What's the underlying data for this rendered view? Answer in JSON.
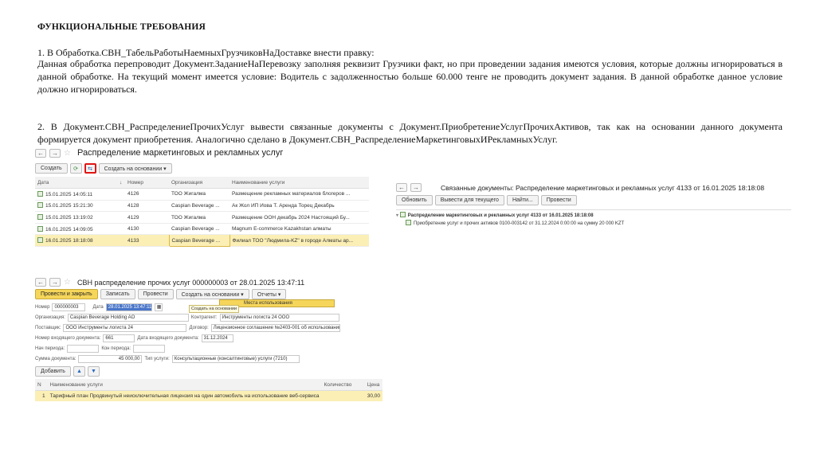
{
  "doc": {
    "heading": "ФУНКЦИОНАЛЬНЫЕ ТРЕБОВАНИЯ",
    "item1_title": "1.   В Обработка.СВН_ТабельРаботыНаемныхГрузчиковНаДоставке внести правку:",
    "item1_body": "Данная обработка перепроводит Документ.ЗаданиеНаПеревозку заполняя реквизит Грузчики факт, но при проведении задания имеются условия, которые должны игнорироваться в данной обработке. На текущий момент имеется условие: Водитель с задолженностью больше 60.000 тенге не проводить документ задания. В данной обработке данное условие должно игнорироваться.",
    "item2_body": "2. В Документ.СВН_РаспределениеПрочихУслуг вывести связанные документы с Документ.ПриобретениеУслугПрочихАктивов, так как на основании данного документа формируется документ приобретения. Аналогично сделано в Документ.СВН_РаспределениеМаркетинговыхИРекламныхУслуг."
  },
  "list_window": {
    "title": "Распределение маркетинговых и рекламных услуг",
    "create_btn": "Создать",
    "create_based_btn": "Создать на основании ▾",
    "columns": [
      "Дата",
      "↓",
      "Номер",
      "Организация",
      "Наименование услуги"
    ],
    "rows": [
      {
        "date": "15.01.2025 14:05:11",
        "num": "4126",
        "org": "ТОО Жигалма",
        "name": "Размещение рекламных материалов  блогеров ..."
      },
      {
        "date": "15.01.2025 15:21:30",
        "num": "4128",
        "org": "Caspian Beverage ...",
        "name": "Ак Жол ИП Иова Т. Аренда Торец Декабрь"
      },
      {
        "date": "15.01.2025 13:19:02",
        "num": "4129",
        "org": "ТОО Жигалма",
        "name": "Размещение ООН декабрь 2024 Настоящий Бу..."
      },
      {
        "date": "16.01.2025 14:09:05",
        "num": "4130",
        "org": "Caspian Beverage ...",
        "name": "Magnum E-commerce Kazakhstan алматы"
      },
      {
        "date": "16.01.2025 18:18:08",
        "num": "4133",
        "org": "Caspian Beverage ...",
        "name": "Филиал ТОО \"Людмила-KZ\" в городе Алматы ар..."
      }
    ]
  },
  "related_window": {
    "title": "Связанные документы: Распределение маркетинговых и рекламных услуг 4133 от 16.01.2025 18:18:08",
    "buttons": [
      "Обновить",
      "Вывести для текущего",
      "Найти...",
      "Провести"
    ],
    "tree_root": "Распределение маркетинговых и рекламных услуг 4133 от 16.01.2025 18:18:08",
    "tree_child": "Приобретение услуг и прочих активов 0100-003142 от 31.12.2024 0:00:00 на сумму 20 000 KZT"
  },
  "form_window": {
    "title": "СВН распределение прочих услуг 000000003 от 28.01.2025 13:47:11",
    "buttons": [
      "Провести и закрыть",
      "Записать",
      "Провести",
      "Создать на основании ▾",
      "Отчеты ▾"
    ],
    "popup_item": "Места использования",
    "popup_tooltip": "Создать на основании",
    "fields": {
      "number_label": "Номер",
      "number": "000000003",
      "date_label": "Дата",
      "date": "28.01.2025 13:47:11",
      "org_label": "Организация:",
      "org": "Caspian Beverage Holding AO",
      "counter_label": "Контрагент:",
      "counter": "Инструменты логиста 24 ООО",
      "supplier_label": "Поставщик:",
      "supplier": "ООО Инструменты логиста 24",
      "contract_label": "Договор:",
      "contract": "Лицензионное соглашение №2403-001 об использовании пр...",
      "in_num_label": "Номер входящего документа:",
      "in_num": "661",
      "in_date_label": "Дата входящего документа:",
      "in_date": "31.12.2024",
      "start_label": "Нач периода:",
      "end_label": "Кон периода:",
      "sum_label": "Сумма документа:",
      "sum": "45 000,00",
      "service_type_label": "Тип услуги:",
      "service_type": "Консультационные (консалтинговые) услуги (7210)"
    },
    "add_btn": "Добавить",
    "table_cols": [
      "N",
      "Наименование услуги",
      "Количество",
      "Цена"
    ],
    "table_row": {
      "n": "1",
      "name": "Тарифный план Продвинутый неисключительная лицензия на один автомобиль на использование веб-сервиса",
      "qty": "",
      "price": "30,00"
    }
  }
}
